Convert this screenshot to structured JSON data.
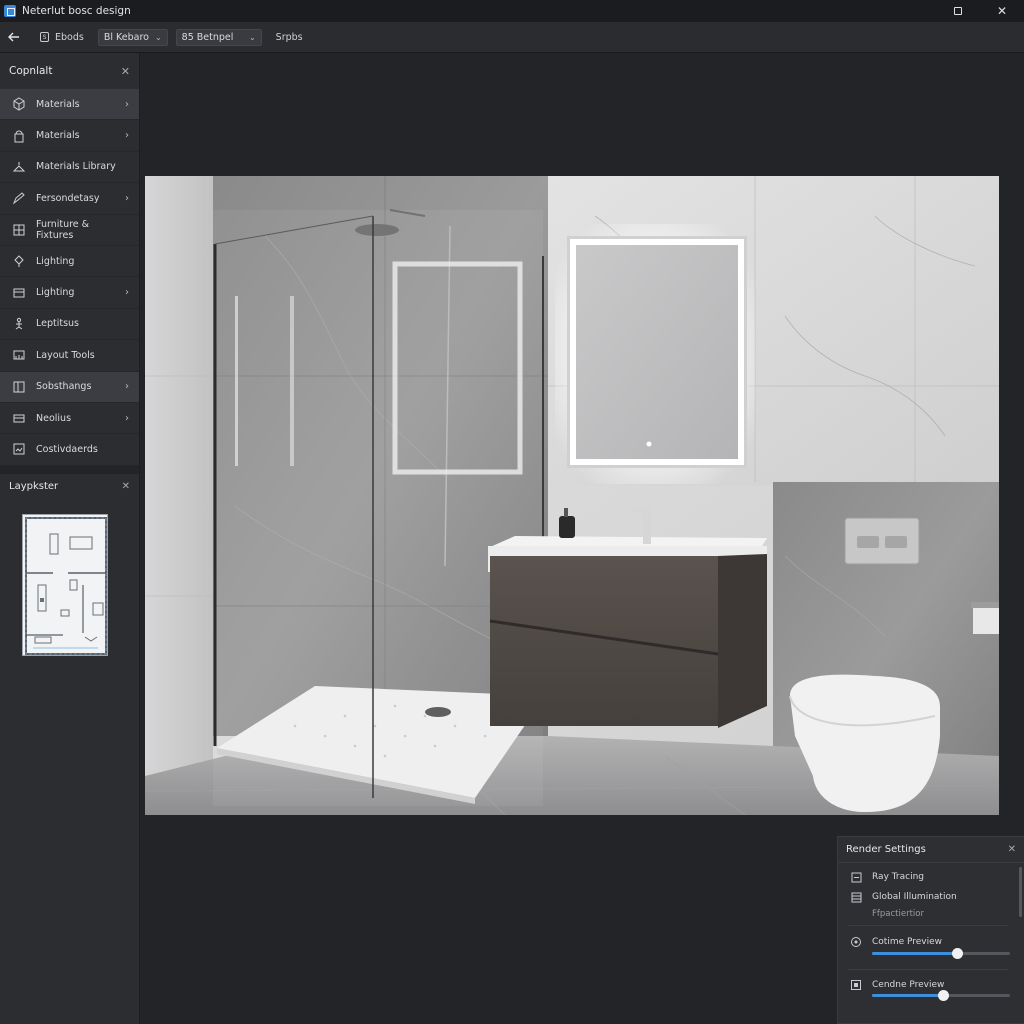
{
  "window": {
    "title": "Neterlut bosc design",
    "close_glyph": "✕"
  },
  "toolbar": {
    "tools_label": "Ebods",
    "tools_glyph": "S",
    "select1_value": "Bl Kebaro",
    "select2_value": "85 Betnpel",
    "settings_label": "Srpbs"
  },
  "sidebar": {
    "header": "Copnlalt",
    "items": [
      {
        "label": "Materials",
        "icon": "cube-icon",
        "has_arrow": true,
        "active": true
      },
      {
        "label": "Materials",
        "icon": "bucket-icon",
        "has_arrow": true,
        "active": false
      },
      {
        "label": "Materials Library",
        "icon": "hanger-icon",
        "has_arrow": false,
        "active": false
      },
      {
        "label": "Fersondetasy",
        "icon": "pencil-icon",
        "has_arrow": true,
        "active": false
      },
      {
        "label": "Furniture & Fixtures",
        "icon": "cabinet-icon",
        "has_arrow": false,
        "active": false
      },
      {
        "label": "Lighting",
        "icon": "lamp-icon",
        "has_arrow": false,
        "active": false
      },
      {
        "label": "Lighting",
        "icon": "box-icon",
        "has_arrow": true,
        "active": false
      },
      {
        "label": "Leptitsus",
        "icon": "figure-icon",
        "has_arrow": false,
        "active": false
      },
      {
        "label": "Layout Tools",
        "icon": "ruler-icon",
        "has_arrow": false,
        "active": false
      },
      {
        "label": "Sobsthangs",
        "icon": "layers-icon",
        "has_arrow": true,
        "active": true
      },
      {
        "label": "Neolius",
        "icon": "tray-icon",
        "has_arrow": true,
        "active": false
      },
      {
        "label": "Costivdaerds",
        "icon": "frame-icon",
        "has_arrow": false,
        "active": false
      }
    ],
    "arrow_glyph": "›",
    "close_glyph": "✕",
    "layout_header": "Laypkster"
  },
  "render_settings": {
    "title": "Render Settings",
    "close_glyph": "✕",
    "ray_tracing": "Ray Tracing",
    "global_illumination": "Global Illumination",
    "sub_label": "Ffpactiertior",
    "preview1_label": "Cotime Preview",
    "preview1_value": 0.62,
    "preview2_label": "Cendne Preview",
    "preview2_value": 0.52
  },
  "colors": {
    "accent": "#3d8fdc",
    "background": "#232427",
    "panel": "#2c2d31"
  }
}
